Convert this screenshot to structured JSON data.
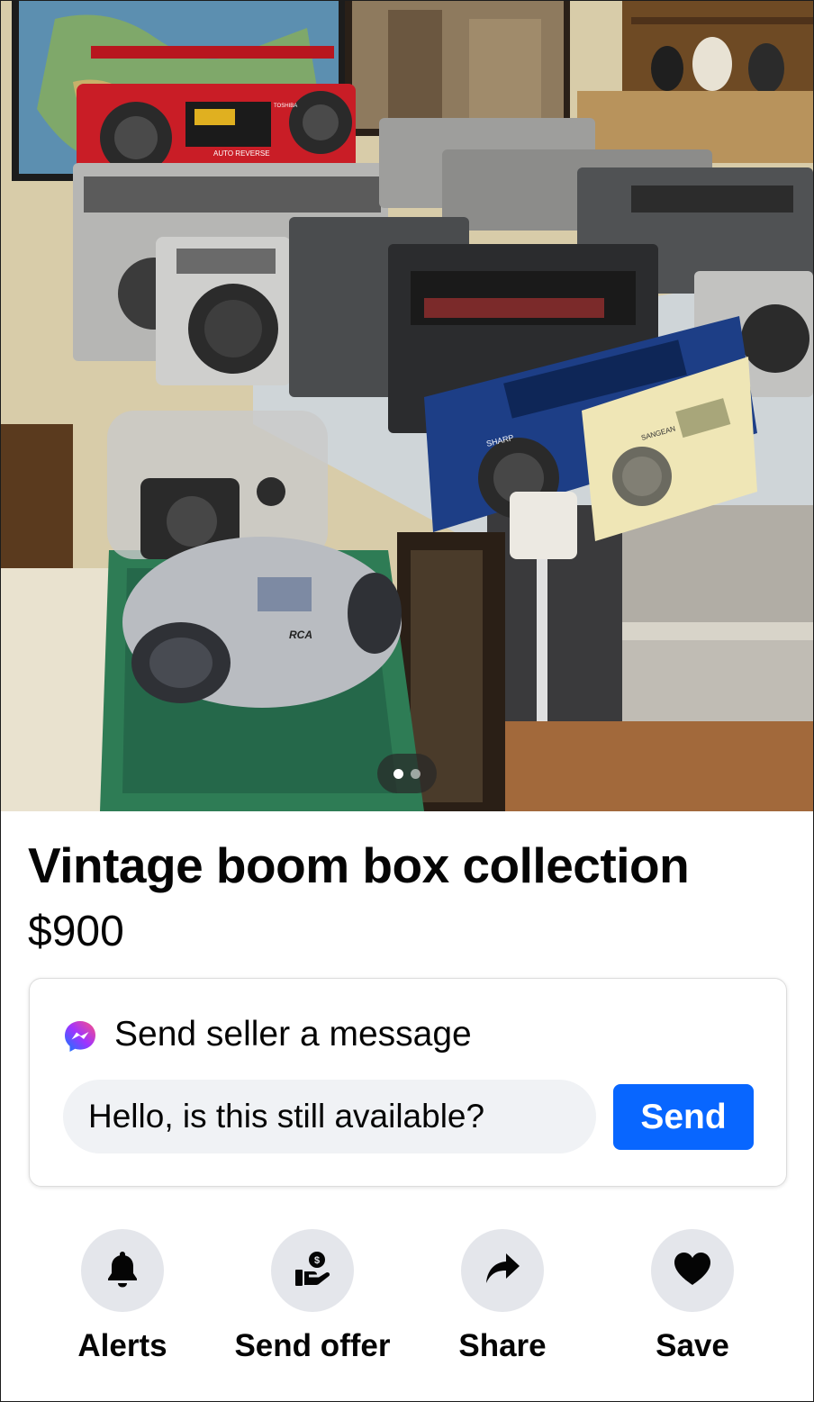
{
  "listing": {
    "title": "Vintage boom box collection",
    "price": "$900",
    "photo_count": 2,
    "current_photo": 1
  },
  "message_card": {
    "header": "Send seller a message",
    "icon": "messenger-icon",
    "input_value": "Hello, is this still available?",
    "send_label": "Send",
    "send_color": "#0866ff"
  },
  "actions": [
    {
      "label": "Alerts",
      "icon": "bell-icon"
    },
    {
      "label": "Send offer",
      "icon": "offer-icon"
    },
    {
      "label": "Share",
      "icon": "share-icon"
    },
    {
      "label": "Save",
      "icon": "heart-icon"
    }
  ],
  "photo_labels": {
    "brand_1": "TOSHIBA",
    "brand_2": "SHARP",
    "brand_3": "SANGEAN",
    "brand_4": "RCA",
    "tape_label": "AUTO REVERSE"
  }
}
